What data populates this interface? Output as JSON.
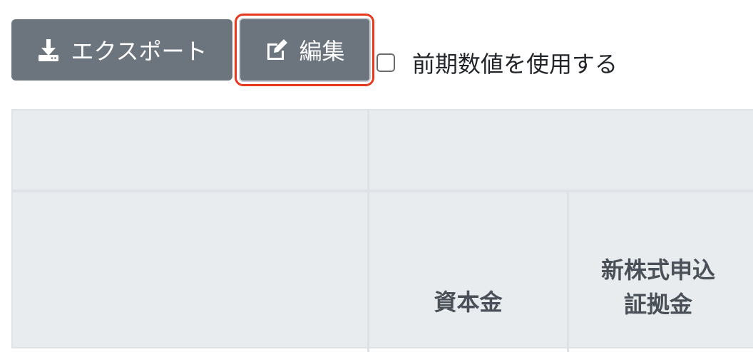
{
  "toolbar": {
    "export_label": "エクスポート",
    "export_icon": "download-icon",
    "edit_label": "編集",
    "edit_icon": "edit-icon",
    "highlight_color": "#e8391f",
    "button_color": "#6c757d",
    "prev_period_label": "前期数値を使用する",
    "prev_period_checked": false
  },
  "table": {
    "columns": [
      {
        "label": "資本金"
      },
      {
        "label_line1": "新株式申込",
        "label_line2": "証拠金"
      }
    ]
  }
}
